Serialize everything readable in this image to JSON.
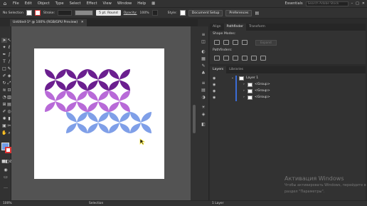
{
  "menubar": {
    "items": [
      "File",
      "Edit",
      "Object",
      "Type",
      "Select",
      "Effect",
      "View",
      "Window",
      "Help"
    ],
    "workspace": "Essentials",
    "search_placeholder": "Search Adobe Stock"
  },
  "controlbar": {
    "selection_label": "No Selection",
    "stroke_label": "Stroke:",
    "stroke_profile": "5 pt. Round",
    "opacity_label": "Opacity:",
    "opacity_value": "100%",
    "style_label": "Style:",
    "document_setup": "Document Setup",
    "preferences": "Preferences"
  },
  "document_tab": {
    "title": "Untitled-1* @ 100% (RGB/GPU Preview)"
  },
  "properties_panel": {
    "tabs": [
      "Align",
      "Pathfinder",
      "Transform"
    ],
    "active_tab": "Pathfinder",
    "shape_modes_label": "Shape Modes:",
    "pathfinders_label": "Pathfinders:",
    "expand_label": "Expand"
  },
  "layers_panel": {
    "tabs": [
      "Layers",
      "Libraries"
    ],
    "layer_name": "Layer 1",
    "groups": [
      "<Group>",
      "<Group>",
      "<Group>"
    ],
    "footer_count": "1 Layer"
  },
  "statusbar": {
    "zoom": "100%",
    "tool": "Selection"
  },
  "watermark": {
    "title": "Активация Windows",
    "line1": "Чтобы активировать Windows, перейдите в",
    "line2": "раздел \"Параметры\"."
  },
  "artwork": {
    "rows": [
      {
        "color": "#6b1f8f",
        "columns": 4
      },
      {
        "color": "#b86ad8",
        "columns": 4
      },
      {
        "color": "#7f9fe8",
        "columns": 4
      }
    ]
  },
  "colors": {
    "accent_blue": "#3b6cd6",
    "fill_swatch": "#6f9be6",
    "ui_dark": "#323232",
    "canvas_gray": "#535353"
  }
}
